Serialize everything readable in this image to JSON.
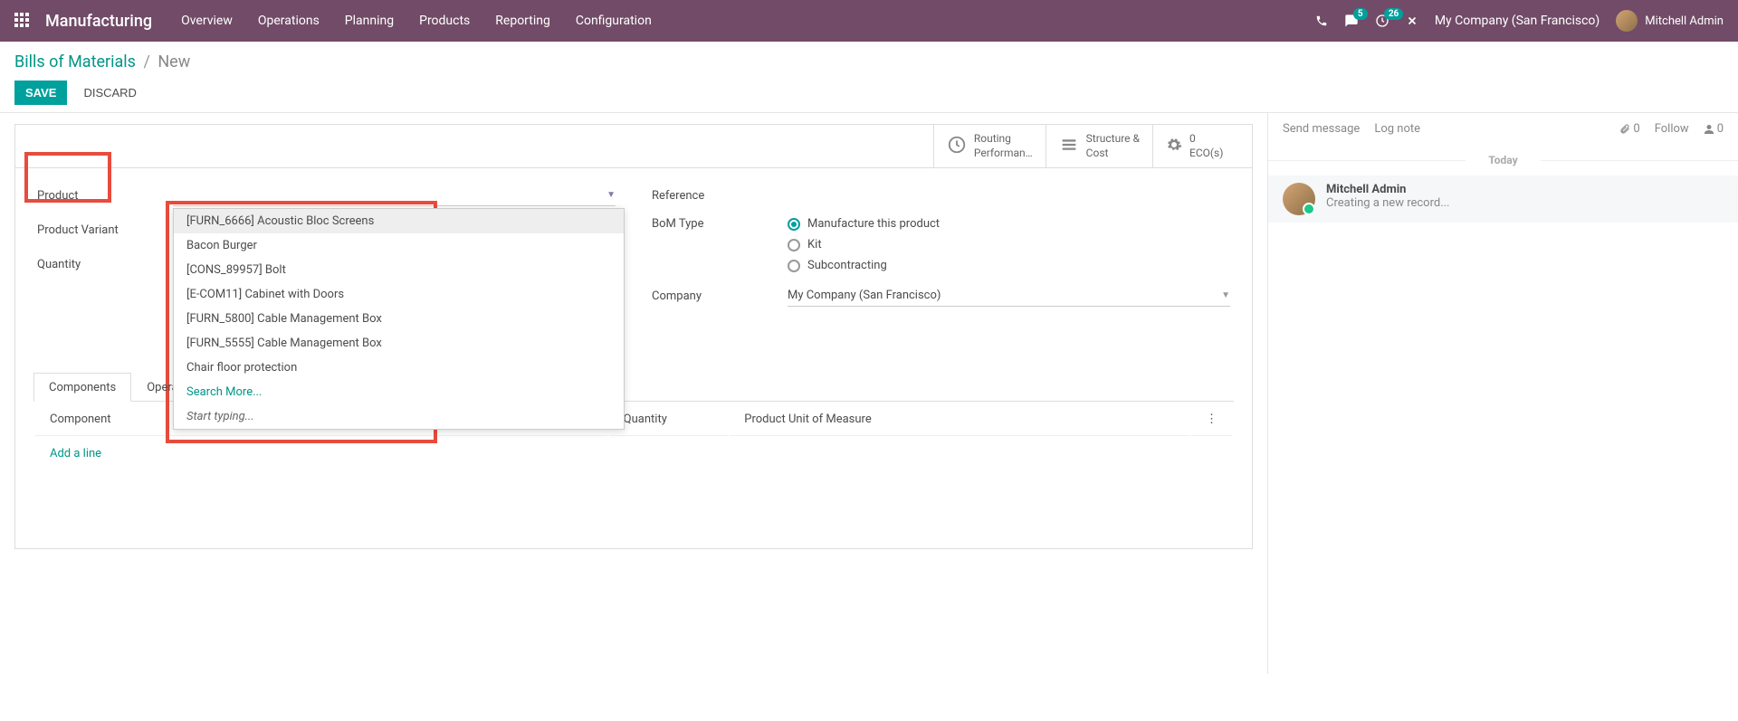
{
  "nav": {
    "brand": "Manufacturing",
    "items": [
      "Overview",
      "Operations",
      "Planning",
      "Products",
      "Reporting",
      "Configuration"
    ],
    "msg_badge": "5",
    "clock_badge": "26",
    "company": "My Company (San Francisco)",
    "user": "Mitchell Admin"
  },
  "breadcrumb": {
    "root": "Bills of Materials",
    "current": "New"
  },
  "buttons": {
    "save": "SAVE",
    "discard": "DISCARD"
  },
  "stat_buttons": {
    "routing": {
      "line1": "Routing",
      "line2": "Performan…"
    },
    "structure": {
      "line1": "Structure &",
      "line2": "Cost"
    },
    "eco": {
      "line1": "0",
      "line2": "ECO(s)"
    }
  },
  "form": {
    "left": {
      "product_label": "Product",
      "variant_label": "Product Variant",
      "quantity_label": "Quantity"
    },
    "right": {
      "reference_label": "Reference",
      "bom_type_label": "BoM Type",
      "bom_opts": [
        "Manufacture this product",
        "Kit",
        "Subcontracting"
      ],
      "company_label": "Company",
      "company_value": "My Company (San Francisco)"
    }
  },
  "dropdown": {
    "items": [
      "[FURN_6666] Acoustic Bloc Screens",
      "Bacon Burger",
      "[CONS_89957] Bolt",
      "[E-COM11] Cabinet with Doors",
      "[FURN_5800] Cable Management Box",
      "[FURN_5555] Cable Management Box",
      "Chair floor protection"
    ],
    "search_more": "Search More...",
    "start_typing": "Start typing..."
  },
  "tabs": {
    "components": "Components",
    "operations_partial": "Opera",
    "col_component": "Component",
    "col_quantity": "Quantity",
    "col_uom": "Product Unit of Measure",
    "add_line": "Add a line"
  },
  "chatter": {
    "send": "Send message",
    "log": "Log note",
    "attach_count": "0",
    "follow": "Follow",
    "follower_count": "0",
    "today": "Today",
    "msg_author": "Mitchell Admin",
    "msg_text": "Creating a new record..."
  }
}
